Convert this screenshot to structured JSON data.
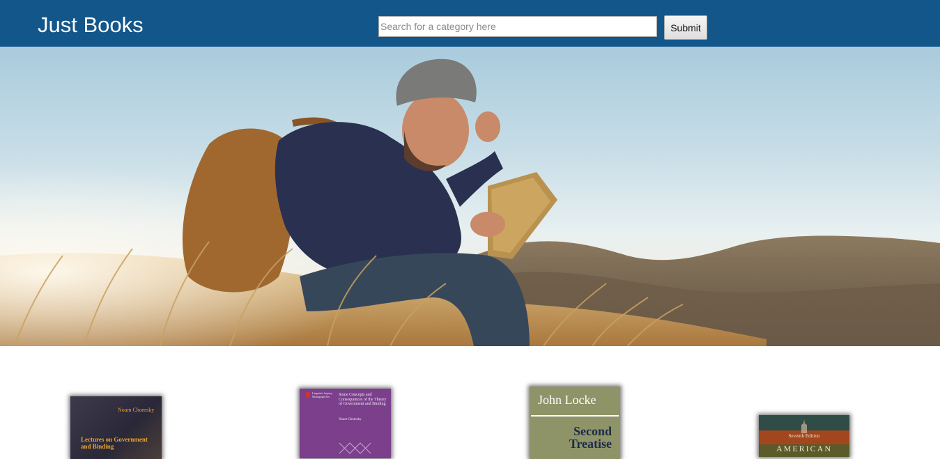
{
  "header": {
    "brand": "Just Books",
    "search": {
      "placeholder": "Search for a category here",
      "value": ""
    },
    "submit_label": "Submit"
  },
  "colors": {
    "header_bg": "#13578a",
    "brand_text": "#ffffff"
  },
  "books": [
    {
      "author": "Noam Chomsky",
      "title": "Lectures on Government and Binding"
    },
    {
      "publisher": "Linguistic Inquiry Monograph Six",
      "title": "Some Concepts and Consequences of the Theory of Government and Binding",
      "author": "Noam Chomsky"
    },
    {
      "author": "John Locke",
      "title": "Second Treatise"
    },
    {
      "edition": "Seventh Edition",
      "title": "AMERICAN"
    }
  ]
}
